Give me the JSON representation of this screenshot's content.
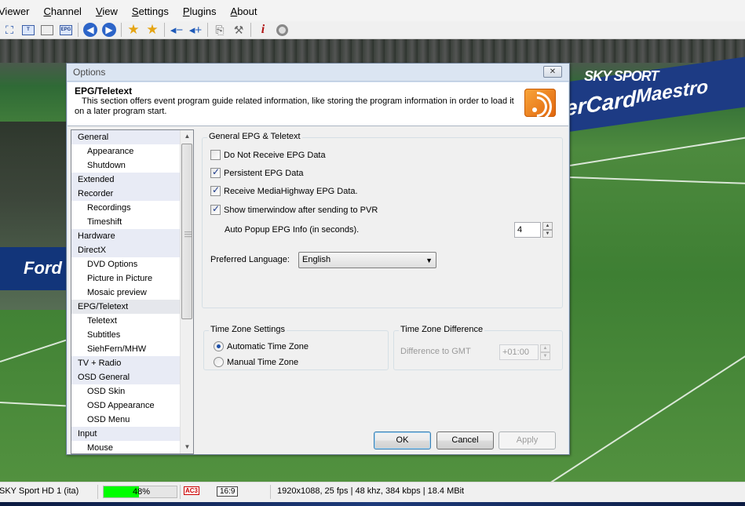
{
  "menu": [
    {
      "label": "Viewer",
      "key": ""
    },
    {
      "label": "Channel",
      "key": "C"
    },
    {
      "label": "View",
      "key": "V"
    },
    {
      "label": "Settings",
      "key": "S"
    },
    {
      "label": "Plugins",
      "key": "P"
    },
    {
      "label": "About",
      "key": "A"
    }
  ],
  "toolbar": {
    "epg_label": "EPG",
    "icons": [
      "fullscreen-icon",
      "teletext-icon",
      "screen-icon",
      "epg-icon",
      "back-icon",
      "forward-icon",
      "favorite-icon",
      "favorite-add-icon",
      "volume-down-icon",
      "volume-up-icon",
      "record-icon",
      "tools-icon",
      "info-icon",
      "disc-icon"
    ]
  },
  "video": {
    "overlay_logo": "SKY SPORT",
    "ad_text_1": "erCard",
    "ad_text_2": "Maestro",
    "ad_text_3": "Ford"
  },
  "dialog": {
    "title": "Options",
    "close_symbol": "✕",
    "header": {
      "title": "EPG/Teletext",
      "description_line1": "This section offers event program guide related information, like storing the program information in order to load it",
      "description_line2": "on a later program start."
    },
    "tree": [
      {
        "label": "General",
        "type": "cat"
      },
      {
        "label": "Appearance",
        "type": "sub"
      },
      {
        "label": "Shutdown",
        "type": "sub"
      },
      {
        "label": "Extended",
        "type": "cat"
      },
      {
        "label": "Recorder",
        "type": "cat"
      },
      {
        "label": "Recordings",
        "type": "sub"
      },
      {
        "label": "Timeshift",
        "type": "sub"
      },
      {
        "label": "Hardware",
        "type": "cat"
      },
      {
        "label": "DirectX",
        "type": "cat"
      },
      {
        "label": "DVD Options",
        "type": "sub"
      },
      {
        "label": "Picture in Picture",
        "type": "sub"
      },
      {
        "label": "Mosaic preview",
        "type": "sub"
      },
      {
        "label": "EPG/Teletext",
        "type": "cat",
        "selected": true
      },
      {
        "label": "Teletext",
        "type": "sub"
      },
      {
        "label": "Subtitles",
        "type": "sub"
      },
      {
        "label": "SiehFern/MHW",
        "type": "sub"
      },
      {
        "label": "TV + Radio",
        "type": "cat"
      },
      {
        "label": "OSD General",
        "type": "cat"
      },
      {
        "label": "OSD Skin",
        "type": "sub"
      },
      {
        "label": "OSD Appearance",
        "type": "sub"
      },
      {
        "label": "OSD Menu",
        "type": "sub"
      },
      {
        "label": "Input",
        "type": "cat"
      },
      {
        "label": "Mouse",
        "type": "sub"
      }
    ],
    "epg_group": {
      "legend": "General EPG & Teletext",
      "options": [
        {
          "label": "Do Not Receive EPG Data",
          "checked": false
        },
        {
          "label": "Persistent EPG Data",
          "checked": true
        },
        {
          "label": "Receive MediaHighway EPG Data.",
          "checked": true
        },
        {
          "label": "Show timerwindow after sending to PVR",
          "checked": true
        }
      ],
      "popup_label": "Auto Popup EPG Info (in seconds).",
      "popup_value": "4",
      "language_label": "Preferred Language:",
      "language_value": "English"
    },
    "timezone_group": {
      "legend": "Time Zone Settings",
      "auto_label": "Automatic Time Zone",
      "manual_label": "Manual Time Zone",
      "selected": "auto"
    },
    "difference_group": {
      "legend": "Time Zone Difference",
      "label": "Difference to GMT",
      "value": "+01:00"
    },
    "buttons": {
      "ok": "OK",
      "cancel": "Cancel",
      "apply": "Apply"
    }
  },
  "status": {
    "channel": "SKY Sport HD 1 (ita)",
    "signal_percent": 48,
    "signal_label": "48%",
    "audio_badge": "AC3",
    "aspect": "16:9",
    "stream_info": "1920x1088, 25 fps | 48 khz, 384 kbps | 18.4 MBit"
  },
  "colors": {
    "signal_fill": "#00ff00",
    "dialog_bg": "#f0f0f0",
    "accent": "#2c64c8"
  }
}
